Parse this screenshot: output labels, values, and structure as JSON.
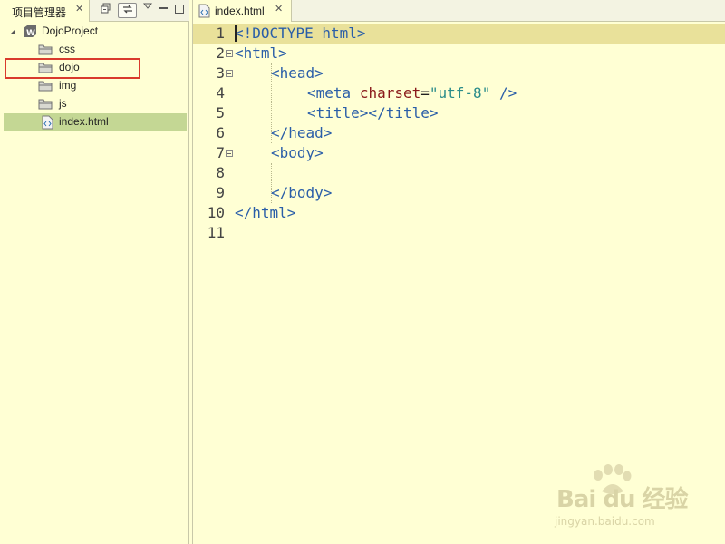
{
  "left_panel": {
    "tab_label": "项目管理器",
    "tab_close": "✕",
    "toolbar": {
      "collapse_icon": "collapse-all-icon",
      "link_icon": "link-with-editor-icon",
      "menu_icon": "view-menu-icon",
      "minimize_icon": "minimize-icon",
      "maximize_icon": "maximize-icon"
    },
    "tree": [
      {
        "label": "DojoProject",
        "type": "project",
        "expanded": true
      },
      {
        "label": "css",
        "type": "folder"
      },
      {
        "label": "dojo",
        "type": "folder",
        "highlighted": true
      },
      {
        "label": "img",
        "type": "folder"
      },
      {
        "label": "js",
        "type": "folder"
      },
      {
        "label": "index.html",
        "type": "html-file",
        "selected": true
      }
    ]
  },
  "editor": {
    "tab_label": "index.html",
    "tab_close": "✕",
    "lines": [
      {
        "num": "1"
      },
      {
        "num": "2"
      },
      {
        "num": "3"
      },
      {
        "num": "4"
      },
      {
        "num": "5"
      },
      {
        "num": "6"
      },
      {
        "num": "7"
      },
      {
        "num": "8"
      },
      {
        "num": "9"
      },
      {
        "num": "10"
      },
      {
        "num": "11"
      }
    ],
    "code": {
      "l1_doctype": "<!DOCTYPE html>",
      "l2_open": "<html>",
      "l3_head": "<head>",
      "l4_meta_open": "<meta",
      "l4_attr": "charset",
      "l4_eq": "=",
      "l4_val": "\"utf-8\"",
      "l4_close": " />",
      "l5_title": "<title></title>",
      "l6_head_close": "</head>",
      "l7_body": "<body>",
      "l9_body_close": "</body>",
      "l10_html_close": "</html>"
    }
  },
  "colors": {
    "background": "#ffffd4",
    "current_line": "#e9e19a",
    "selected_row": "#c4d794",
    "tag": "#2a5ea8",
    "attribute": "#8a1a1a",
    "attribute_value": "#2a8c8a",
    "highlight_box": "#d93a2c"
  },
  "watermark": {
    "brand": "Bai du 经验",
    "url": "jingyan.baidu.com"
  }
}
